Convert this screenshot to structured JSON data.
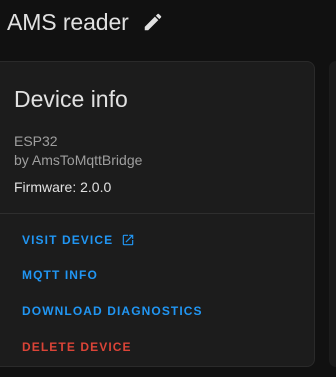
{
  "header": {
    "title": "AMS reader",
    "edit_icon": "pencil-icon"
  },
  "device_card": {
    "title": "Device info",
    "model": "ESP32",
    "manufacturer": "by AmsToMqttBridge",
    "firmware": "Firmware: 2.0.0",
    "actions": [
      {
        "label": "VISIT DEVICE",
        "icon": "open-in-new-icon",
        "color": "#2196f3"
      },
      {
        "label": "MQTT INFO",
        "color": "#2196f3"
      },
      {
        "label": "DOWNLOAD DIAGNOSTICS",
        "color": "#2196f3"
      },
      {
        "label": "DELETE DEVICE",
        "color": "#db4437"
      }
    ]
  },
  "theme": {
    "background": "#111111",
    "card": "#1c1c1c",
    "primary": "#2196f3",
    "danger": "#db4437"
  }
}
